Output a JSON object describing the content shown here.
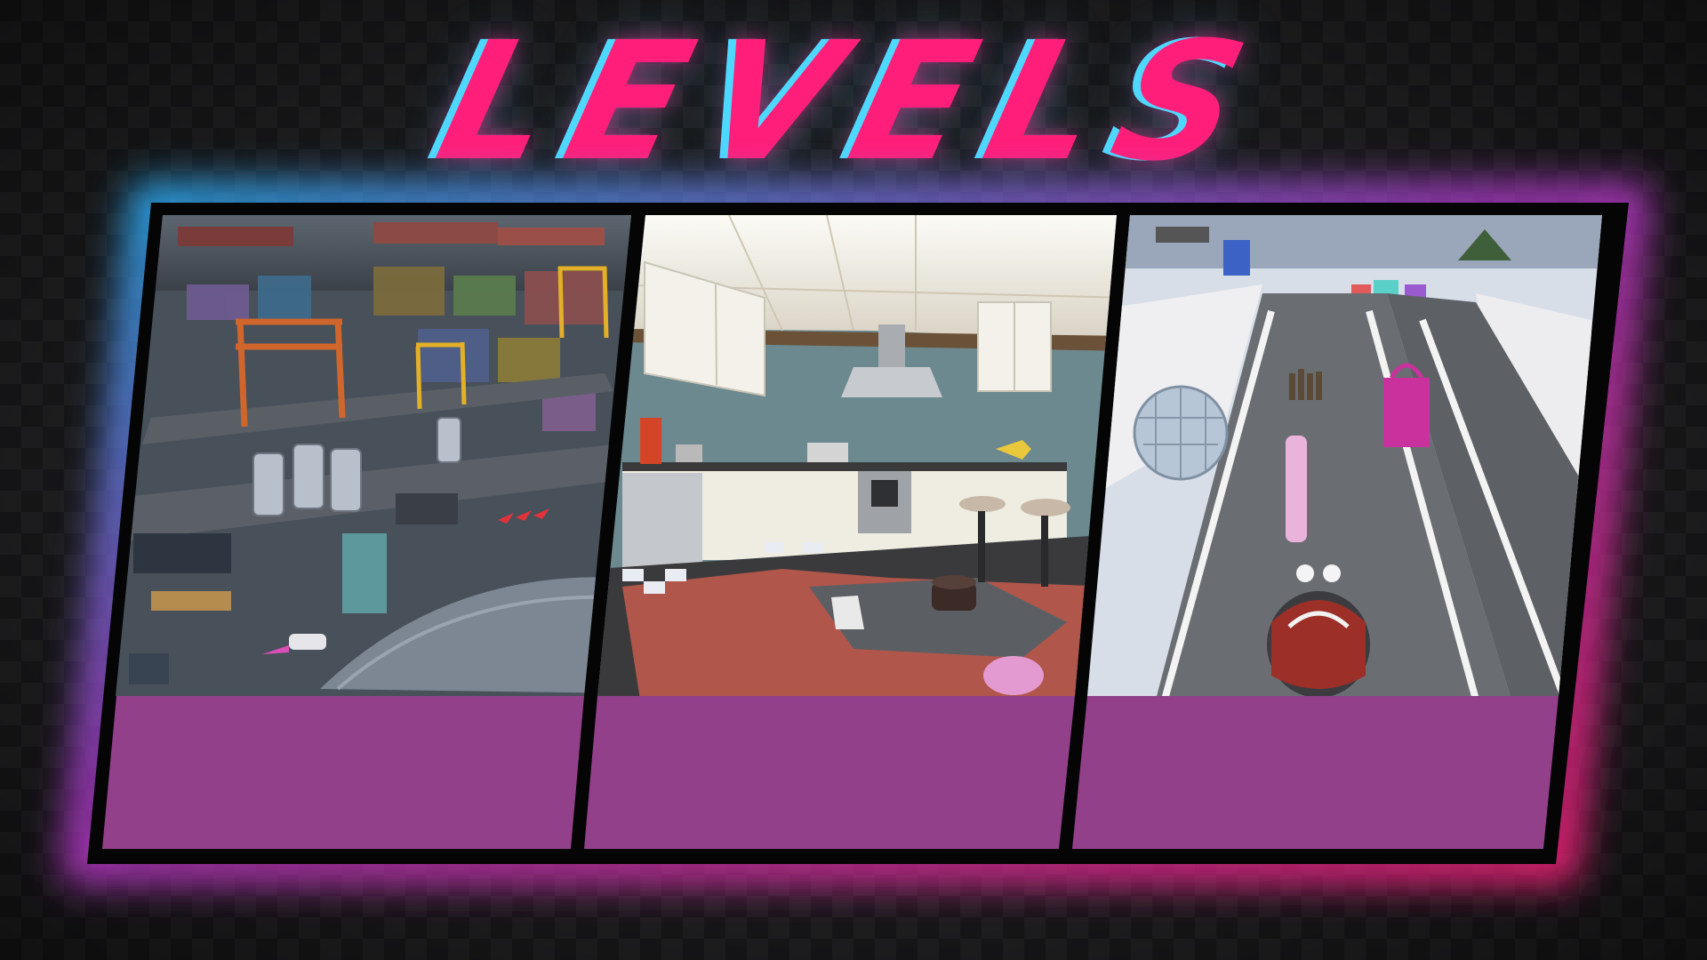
{
  "screen": {
    "title": "LEVELS",
    "accent_pink": "#ff1f7a",
    "accent_cyan": "#4fd8ff",
    "label_bar_color": "#92408a"
  },
  "levels": [
    {
      "scene": "shipping-port",
      "label": ""
    },
    {
      "scene": "kitchen",
      "label": ""
    },
    {
      "scene": "party-track",
      "label": ""
    }
  ]
}
